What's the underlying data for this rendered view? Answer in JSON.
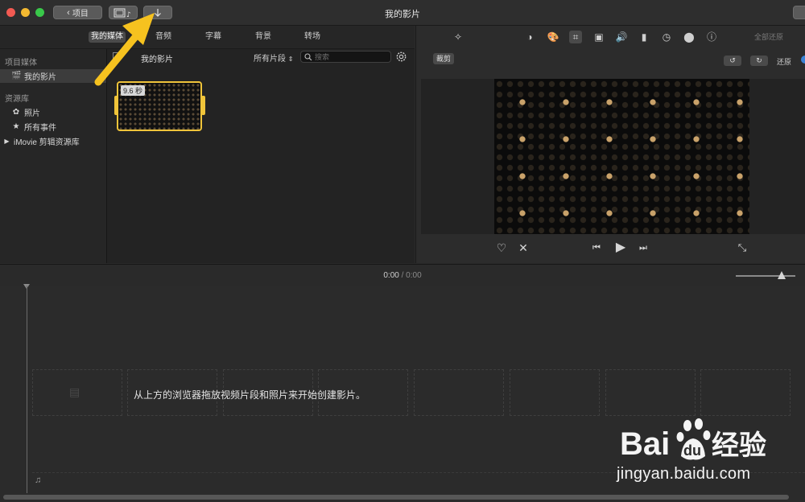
{
  "window": {
    "title": "我的影片",
    "back_button": "项目",
    "colors": {
      "close": "#f25a52",
      "minimize": "#f3b931",
      "zoom": "#39c84a",
      "accent": "#f0c43a"
    }
  },
  "top_tabs": [
    {
      "label": "我的媒体",
      "active": true
    },
    {
      "label": "音频",
      "active": false
    },
    {
      "label": "字幕",
      "active": false
    },
    {
      "label": "背景",
      "active": false
    },
    {
      "label": "转场",
      "active": false
    }
  ],
  "sidebar": {
    "section_project": "项目媒体",
    "project_item": "我的影片",
    "section_library": "资源库",
    "photos": "照片",
    "all_events": "所有事件",
    "imovie_library": "iMovie 剪辑资源库"
  },
  "browser": {
    "title": "我的影片",
    "filter": "所有片段",
    "search_placeholder": "搜索",
    "clip_duration": "9.6 秒"
  },
  "viewer": {
    "crop_label": "裁剪",
    "reset_all": "全部还原",
    "reset": "还原"
  },
  "timeline": {
    "current_time": "0:00",
    "separator": "/",
    "total_time": "0:00",
    "drop_hint": "从上方的浏览器拖放视频片段和照片来开始创建影片。",
    "zoom_level": 0.72
  },
  "watermark": {
    "brand_left": "Bai",
    "brand_right": "经验",
    "url": "jingyan.baidu.com"
  }
}
